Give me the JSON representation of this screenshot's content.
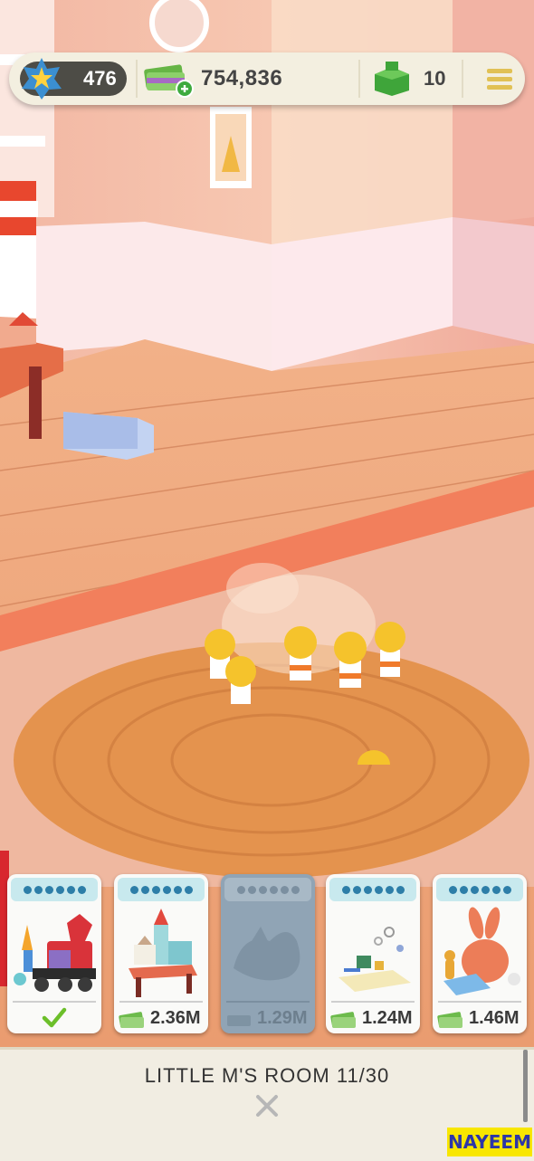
{
  "hud": {
    "level": "476",
    "cash": "754,836",
    "boxes": "10",
    "level_icon": "star-badge-icon",
    "cash_icon": "cash-stack-icon",
    "box_icon": "green-box-icon",
    "menu_icon": "hamburger-menu-icon"
  },
  "cards": [
    {
      "name": "train-toys",
      "price": "",
      "state": "completed",
      "dots": 6
    },
    {
      "name": "castle-table",
      "price": "2.36M",
      "state": "available",
      "dots": 6
    },
    {
      "name": "dinosaur",
      "price": "1.29M",
      "state": "locked",
      "dots": 6
    },
    {
      "name": "craft-set",
      "price": "1.24M",
      "state": "available",
      "dots": 6
    },
    {
      "name": "bunny-toys",
      "price": "1.46M",
      "state": "available",
      "dots": 6
    }
  ],
  "room": {
    "title": "LITTLE M'S ROOM 11/30"
  },
  "watermark": "NAYEEM",
  "colors": {
    "card_header": "#c8e9ee",
    "dot_blue": "#2d7ea8",
    "panel_bg": "#f1ede2",
    "check_green": "#6cbf2a"
  }
}
